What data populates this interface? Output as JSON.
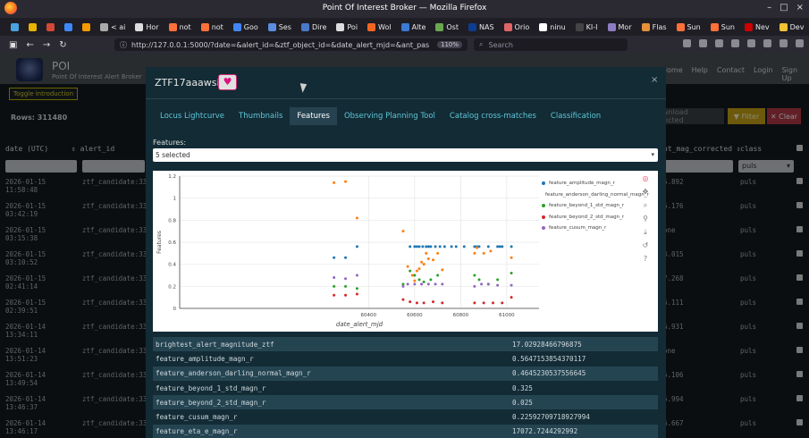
{
  "browser": {
    "window_title": "Point Of Interest Broker — Mozilla Firefox",
    "tabs": [
      {
        "label": "",
        "color": "#4aa3df"
      },
      {
        "label": "",
        "color": "#e8b400"
      },
      {
        "label": "",
        "color": "#d34836"
      },
      {
        "label": "",
        "color": "#3d8af7"
      },
      {
        "label": "",
        "color": "#f59b00"
      },
      {
        "label": "< ai",
        "color": "#aaaaaa"
      },
      {
        "label": "Hor",
        "color": "#dddddd"
      },
      {
        "label": "not",
        "color": "#ff7139"
      },
      {
        "label": "not",
        "color": "#ff7139"
      },
      {
        "label": "Goo",
        "color": "#4285f4"
      },
      {
        "label": "Ses",
        "color": "#5b8de0"
      },
      {
        "label": "Dire",
        "color": "#4a79c8"
      },
      {
        "label": "Poi",
        "color": "#dddddd"
      },
      {
        "label": "Wol",
        "color": "#f26522"
      },
      {
        "label": "Alte",
        "color": "#3a7bd5"
      },
      {
        "label": "Ost",
        "color": "#6aa84f"
      },
      {
        "label": "NAS",
        "color": "#0b3d91"
      },
      {
        "label": "Orio",
        "color": "#e06666"
      },
      {
        "label": "ninu",
        "color": "#ffffff"
      },
      {
        "label": "KI-I",
        "color": "#444444"
      },
      {
        "label": "Mor",
        "color": "#8e7cc3"
      },
      {
        "label": "Flas",
        "color": "#e69138"
      },
      {
        "label": "Sun",
        "color": "#ff7139"
      },
      {
        "label": "Sun",
        "color": "#ff7139"
      },
      {
        "label": "Nev",
        "color": "#cc0000"
      },
      {
        "label": "Dev",
        "color": "#f1c232"
      },
      {
        "label": "Po",
        "color": "#888888"
      }
    ],
    "url": "http://127.0.0.1:5000/?date=&alert_id=&ztf_object_id=&date_alert_mjd=&ant_pas",
    "zoom": "110%",
    "search_placeholder": "Search"
  },
  "app": {
    "title": "POI",
    "subtitle": "Point Of Interest Alert Broker",
    "nav": [
      "Home",
      "Help",
      "Contact",
      "Login",
      "Sign Up"
    ],
    "toggle_intro": "Toggle introduction",
    "rows_label": "Rows: 311480",
    "download_label": "Download Selected",
    "filter_label": "Filter",
    "clear_label": "Clear",
    "columns": {
      "date": "date (UTC)",
      "alert_id": "alert_id",
      "mag": "nt_mag_corrected",
      "class": "class"
    },
    "class_filter": "puls",
    "rows": [
      {
        "d1": "2026-01-15",
        "d2": "11:58:48",
        "cid": "ztf_candidate:33",
        "mag": "5.892",
        "cls": "puls"
      },
      {
        "d1": "2026-01-15",
        "d2": "03:42:19",
        "cid": "ztf_candidate:33",
        "mag": "5.176",
        "cls": "puls"
      },
      {
        "d1": "2026-01-15",
        "d2": "03:15:38",
        "cid": "ztf_candidate:33",
        "mag": "one",
        "cls": "puls"
      },
      {
        "d1": "2026-01-15",
        "d2": "03:10:52",
        "cid": "ztf_candidate:33",
        "mag": "4.015",
        "cls": "puls"
      },
      {
        "d1": "2026-01-15",
        "d2": "02:41:14",
        "cid": "ztf_candidate:33",
        "mag": "7.268",
        "cls": "puls"
      },
      {
        "d1": "2026-01-15",
        "d2": "02:39:51",
        "cid": "ztf_candidate:33",
        "mag": "6.111",
        "cls": "puls"
      },
      {
        "d1": "2026-01-14",
        "d2": "13:34:11",
        "cid": "ztf_candidate:33",
        "mag": "6.931",
        "cls": "puls"
      },
      {
        "d1": "2026-01-14",
        "d2": "13:51:23",
        "cid": "ztf_candidate:33",
        "mag": "one",
        "cls": "puls"
      },
      {
        "d1": "2026-01-14",
        "d2": "13:49:54",
        "cid": "ztf_candidate:33",
        "mag": "5.106",
        "cls": "puls"
      },
      {
        "d1": "2026-01-14",
        "d2": "13:46:37",
        "cid": "ztf_candidate:33",
        "mag": "5.994",
        "cls": "puls"
      },
      {
        "d1": "2026-01-14",
        "d2": "13:46:17",
        "cid": "ztf_candidate:33",
        "mag": "6.667",
        "cls": "puls"
      }
    ]
  },
  "modal": {
    "title": "ZTF17aaawsib",
    "close": "×",
    "tabs": [
      "Locus Lightcurve",
      "Thumbnails",
      "Features",
      "Observing Planning Tool",
      "Catalog cross-matches",
      "Classification"
    ],
    "active_tab": 2,
    "features_label": "Features:",
    "features_selected": "5 selected",
    "chart_data": {
      "type": "scatter",
      "xlabel": "date_alert_mjd",
      "ylabel": "Features",
      "xlim": [
        59580,
        61140
      ],
      "ylim": [
        0,
        1.2
      ],
      "xticks": [
        60400,
        60600,
        60800,
        61000
      ],
      "xtick_labels": [
        "60400",
        "60600",
        "60800",
        "61000"
      ],
      "yticks": [
        0,
        0.2,
        0.4,
        0.6,
        0.8,
        1,
        1.2
      ],
      "ytick_labels": [
        "0",
        "0.2",
        "0.4",
        "0.6",
        "0.8",
        "1",
        "1.2"
      ],
      "series": [
        {
          "name": "feature_amplitude_magn_r",
          "color": "#1f77b4",
          "x": [
            60250,
            60300,
            60350,
            60580,
            60600,
            60610,
            60620,
            60635,
            60650,
            60660,
            60670,
            60690,
            60710,
            60730,
            60760,
            60780,
            60815,
            60860,
            60870,
            60880,
            60920,
            60960,
            60970,
            60980,
            61020
          ],
          "y": [
            0.46,
            0.46,
            0.56,
            0.56,
            0.56,
            0.56,
            0.56,
            0.56,
            0.56,
            0.56,
            0.56,
            0.56,
            0.56,
            0.56,
            0.56,
            0.56,
            0.56,
            0.56,
            0.56,
            0.56,
            0.56,
            0.56,
            0.56,
            0.56,
            0.56
          ]
        },
        {
          "name": "feature_anderson_darling_normal_magn_r",
          "color": "#ff7f0e",
          "x": [
            60250,
            60300,
            60350,
            60550,
            60570,
            60590,
            60600,
            60610,
            60620,
            60630,
            60640,
            60650,
            60660,
            60680,
            60700,
            60720,
            60860,
            60870,
            60900,
            60930,
            61020
          ],
          "y": [
            1.14,
            1.15,
            0.82,
            0.7,
            0.38,
            0.3,
            0.25,
            0.34,
            0.36,
            0.42,
            0.4,
            0.5,
            0.45,
            0.44,
            0.5,
            0.35,
            0.5,
            0.55,
            0.5,
            0.52,
            0.46
          ]
        },
        {
          "name": "feature_beyond_1_std_magn_r",
          "color": "#2ca02c",
          "x": [
            60250,
            60300,
            60350,
            60550,
            60580,
            60600,
            60620,
            60640,
            60670,
            60700,
            60860,
            60880,
            60920,
            60960,
            61020
          ],
          "y": [
            0.2,
            0.2,
            0.18,
            0.22,
            0.34,
            0.3,
            0.26,
            0.24,
            0.26,
            0.3,
            0.3,
            0.26,
            0.22,
            0.26,
            0.32
          ]
        },
        {
          "name": "feature_beyond_2_std_magn_r",
          "color": "#d62728",
          "x": [
            60250,
            60300,
            60350,
            60550,
            60580,
            60610,
            60640,
            60680,
            60720,
            60860,
            60900,
            60940,
            60980,
            61020
          ],
          "y": [
            0.12,
            0.12,
            0.13,
            0.08,
            0.06,
            0.05,
            0.05,
            0.06,
            0.05,
            0.05,
            0.05,
            0.05,
            0.05,
            0.1
          ]
        },
        {
          "name": "feature_cusum_magn_r",
          "color": "#9467bd",
          "x": [
            60250,
            60300,
            60350,
            60550,
            60570,
            60600,
            60630,
            60660,
            60690,
            60720,
            60860,
            60890,
            60920,
            60960,
            61020
          ],
          "y": [
            0.28,
            0.27,
            0.3,
            0.2,
            0.22,
            0.22,
            0.22,
            0.22,
            0.22,
            0.22,
            0.2,
            0.22,
            0.22,
            0.21,
            0.21
          ]
        }
      ]
    },
    "toolbar_icons": [
      "bokeh-logo-icon",
      "pan-icon",
      "zoom-icon",
      "wheel-zoom-icon",
      "save-icon",
      "reset-icon",
      "help-icon"
    ],
    "features_table": [
      {
        "k": "brightest_alert_magnitude_ztf",
        "v": "17.02928466796875"
      },
      {
        "k": "feature_amplitude_magn_r",
        "v": "0.5647153854370117"
      },
      {
        "k": "feature_anderson_darling_normal_magn_r",
        "v": "0.4645230537556645"
      },
      {
        "k": "feature_beyond_1_std_magn_r",
        "v": "0.325"
      },
      {
        "k": "feature_beyond_2_std_magn_r",
        "v": "0.025"
      },
      {
        "k": "feature_cusum_magn_r",
        "v": "0.22592709718927994"
      },
      {
        "k": "feature_eta_e_magn_r",
        "v": "17072.7244292992"
      }
    ]
  }
}
